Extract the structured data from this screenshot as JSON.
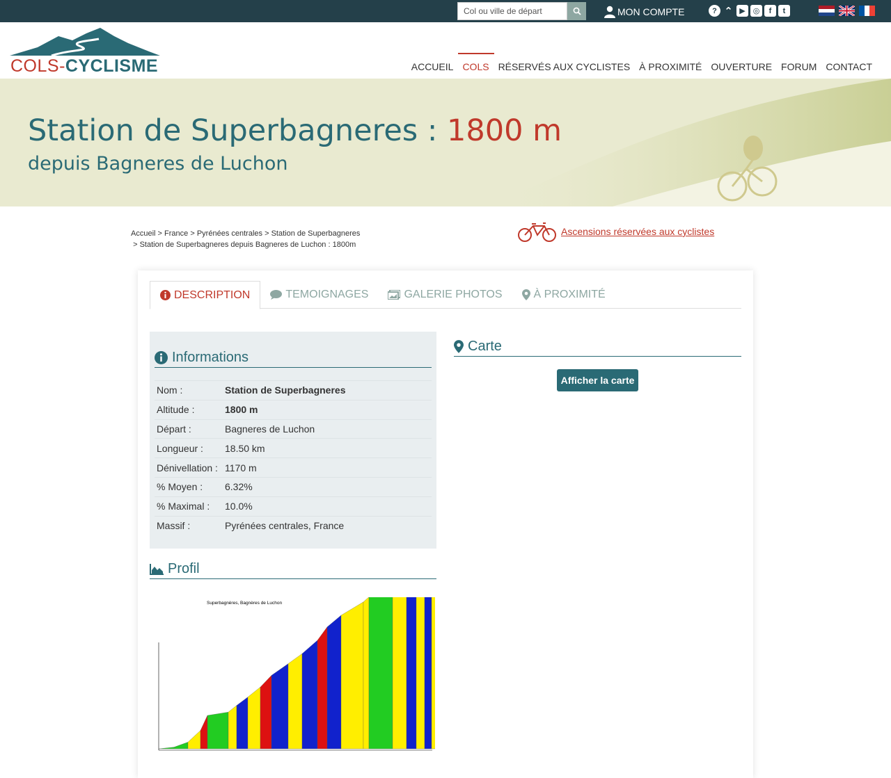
{
  "topbar": {
    "search_placeholder": "Col ou ville de départ",
    "account_label": "MON COMPTE",
    "socials": [
      "help-icon",
      "strava-icon",
      "youtube-icon",
      "instagram-icon",
      "facebook-icon",
      "twitter-icon"
    ],
    "flags": [
      "flag-nl-icon",
      "flag-uk-icon",
      "flag-fr-icon"
    ]
  },
  "logo": {
    "part1": "COLS",
    "sep": "-",
    "part2": "CYCLISME"
  },
  "nav": [
    {
      "label": "ACCUEIL",
      "active": false
    },
    {
      "label": "COLS",
      "active": true
    },
    {
      "label": "RÉSERVÉS AUX CYCLISTES",
      "active": false
    },
    {
      "label": "À PROXIMITÉ",
      "active": false
    },
    {
      "label": "OUVERTURE",
      "active": false
    },
    {
      "label": "FORUM",
      "active": false
    },
    {
      "label": "CONTACT",
      "active": false
    }
  ],
  "banner": {
    "title": "Station de Superbagneres : ",
    "altitude": "1800 m",
    "subtitle": "depuis Bagneres de Luchon"
  },
  "breadcrumb": {
    "items": [
      "Accueil",
      "France",
      "Pyrénées centrales",
      "Station de Superbagneres",
      "Station de Superbagneres depuis Bagneres de Luchon : 1800m"
    ],
    "sep": ">"
  },
  "reserved_link": "Ascensions réservées aux cyclistes",
  "tabs": [
    {
      "label": "DESCRIPTION",
      "icon": "info-icon",
      "active": true
    },
    {
      "label": "TEMOIGNAGES",
      "icon": "comment-icon",
      "active": false
    },
    {
      "label": "GALERIE PHOTOS",
      "icon": "photos-icon",
      "active": false
    },
    {
      "label": "À PROXIMITÉ",
      "icon": "map-marker-icon",
      "active": false
    }
  ],
  "informations": {
    "title": "Informations",
    "rows": [
      {
        "key": "Nom :",
        "value": "Station de Superbagneres",
        "bold": true
      },
      {
        "key": "Altitude :",
        "value": "1800 m",
        "bold": true
      },
      {
        "key": "Départ :",
        "value": "Bagneres de Luchon",
        "bold": false
      },
      {
        "key": "Longueur :",
        "value": "18.50 km",
        "bold": false
      },
      {
        "key": "Dénivellation :",
        "value": "1170 m",
        "bold": false
      },
      {
        "key": "% Moyen :",
        "value": "6.32%",
        "bold": false
      },
      {
        "key": "% Maximal :",
        "value": "10.0%",
        "bold": false
      },
      {
        "key": "Massif :",
        "value": "Pyrénées centrales, France",
        "bold": false
      }
    ]
  },
  "profil": {
    "title": "Profil",
    "chart_title": "Superbagnères,      Bagnères de Luchon"
  },
  "carte": {
    "title": "Carte",
    "button": "Afficher la carte"
  },
  "colors": {
    "topbar": "#24404a",
    "teal": "#2a6a75",
    "red": "#c0392b",
    "muted_green": "#8ea7a2",
    "banner_bg": "#e9ead0",
    "info_bg": "#e9eef0"
  }
}
